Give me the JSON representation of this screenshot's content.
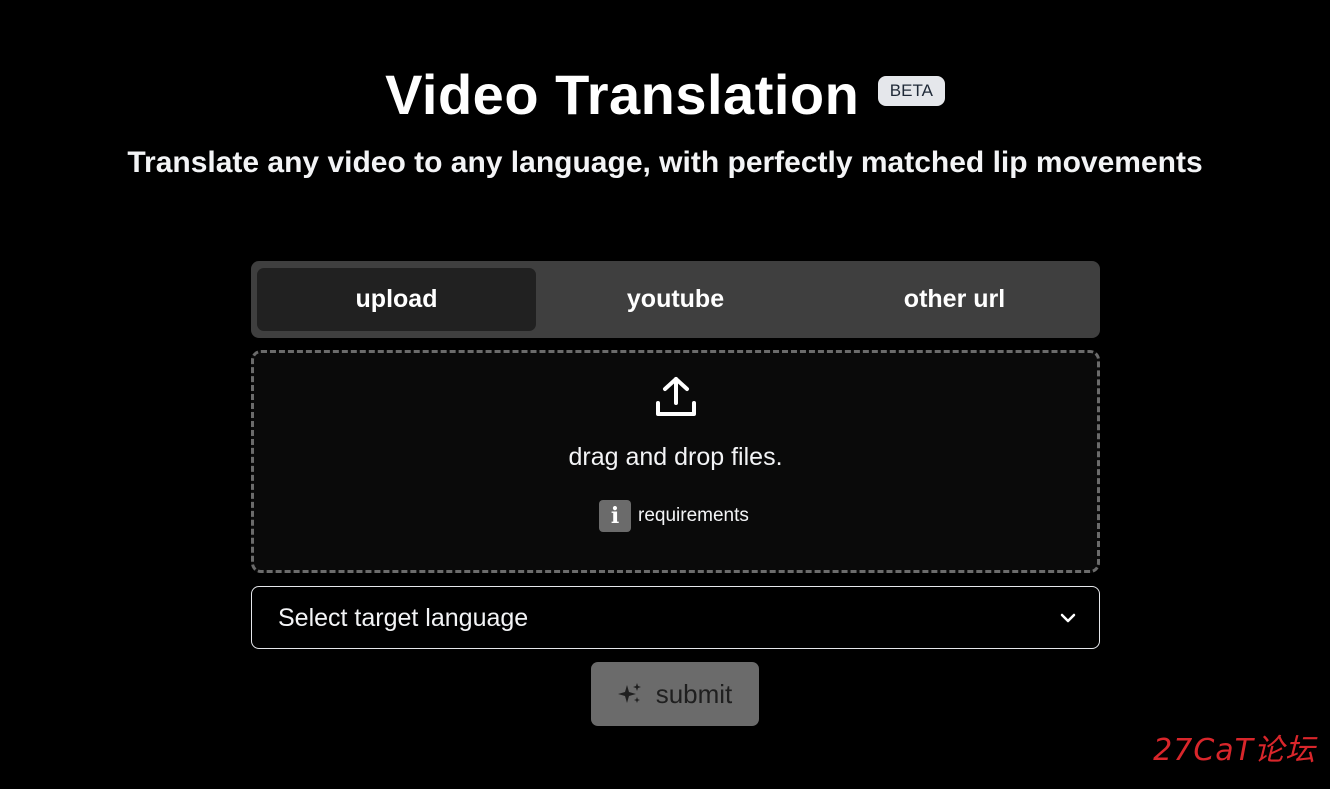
{
  "header": {
    "title": "Video Translation",
    "badge": "BETA",
    "subtitle": "Translate any video to any language, with perfectly matched lip movements"
  },
  "source_tabs": [
    {
      "label": "upload",
      "active": true
    },
    {
      "label": "youtube",
      "active": false
    },
    {
      "label": "other url",
      "active": false
    }
  ],
  "dropzone": {
    "icon": "upload-icon",
    "text": "drag and drop files.",
    "requirements_icon": "info-icon",
    "requirements_label": "requirements"
  },
  "language_select": {
    "placeholder": "Select target language",
    "icon": "chevron-down-icon"
  },
  "submit": {
    "label": "submit",
    "icon": "sparkle-icon"
  },
  "watermark": "27CaT论坛",
  "colors": {
    "background": "#000000",
    "tabs_bg": "#3f3f3f",
    "active_tab_bg": "#212121",
    "submit_bg": "#6b6b6b",
    "badge_bg": "#e5e7eb",
    "watermark": "#d9262b"
  }
}
